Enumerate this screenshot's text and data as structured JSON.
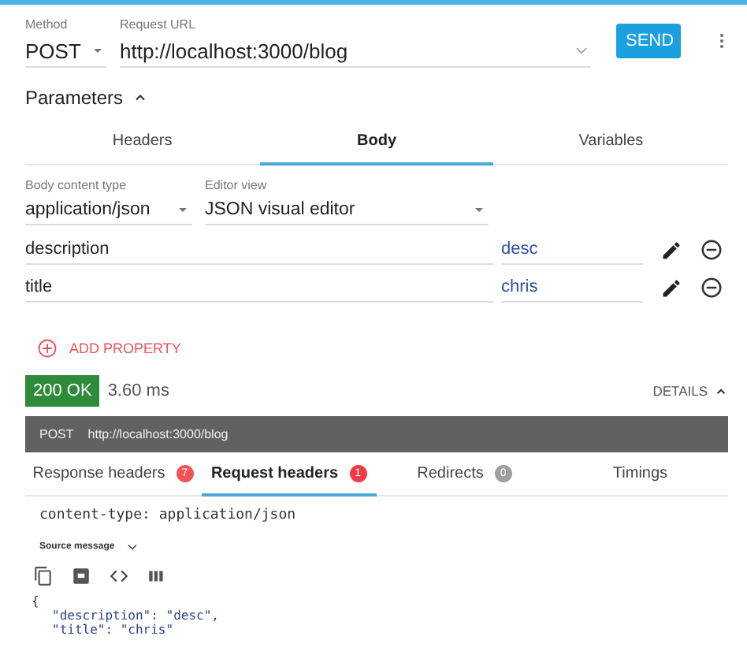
{
  "request": {
    "method_label": "Method",
    "method": "POST",
    "url_label": "Request URL",
    "url": "http://localhost:3000/blog",
    "send": "SEND"
  },
  "parameters": {
    "label": "Parameters",
    "expanded": true
  },
  "param_tabs": [
    {
      "label": "Headers",
      "selected": false
    },
    {
      "label": "Body",
      "selected": true
    },
    {
      "label": "Variables",
      "selected": false
    }
  ],
  "body_content_type": {
    "label": "Body content type",
    "value": "application/json"
  },
  "editor_view": {
    "label": "Editor view",
    "value": "JSON visual editor"
  },
  "properties": [
    {
      "name": "description",
      "value": "desc"
    },
    {
      "name": "title",
      "value": "chris"
    }
  ],
  "add_property": "ADD PROPERTY",
  "status": {
    "code": "200 OK",
    "time": "3.60 ms",
    "details": "DETAILS",
    "details_expanded": true
  },
  "request_bar": {
    "method": "POST",
    "url": "http://localhost:3000/blog"
  },
  "response_tabs": [
    {
      "label": "Response headers",
      "badge": "7",
      "color": "#f05454",
      "selected": false
    },
    {
      "label": "Request headers",
      "badge": "1",
      "color": "#f03a46",
      "selected": true
    },
    {
      "label": "Redirects",
      "badge": "0",
      "color": "#9e9e9e",
      "selected": false
    },
    {
      "label": "Timings",
      "selected": false
    }
  ],
  "headers_text": "content-type: application/json",
  "source_message": {
    "label": "Source message",
    "expanded": false
  },
  "code": {
    "open": "{",
    "lines": [
      "\"description\": \"desc\",",
      "\"title\": \"chris\""
    ]
  }
}
